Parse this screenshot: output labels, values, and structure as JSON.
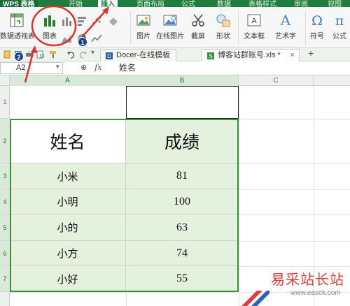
{
  "app": {
    "name": "WPS 表格"
  },
  "ribbon_tabs": [
    "开始",
    "插入",
    "页面布局",
    "公式",
    "数据",
    "表格样式",
    "审阅",
    "视图"
  ],
  "active_tab": "插入",
  "ribbon_buttons": {
    "pivot": "数据透视表",
    "chart": "图表",
    "picture": "图片",
    "online_picture": "在线图片",
    "screenshot": "截屏",
    "shapes": "形状",
    "textbox": "文本框",
    "wordart": "艺术字",
    "symbol": "符号",
    "formula": "公式"
  },
  "document_tabs": [
    "Docer-在线模板",
    "博客站群账号.xls *"
  ],
  "active_doc_tab": "博客站群账号.xls *",
  "name_box": "A2",
  "formula_bar": {
    "fx_label": "fx",
    "content": "姓名"
  },
  "columns": [
    "A",
    "B",
    "C"
  ],
  "rows": [
    "1",
    "2",
    "3",
    "4",
    "5",
    "6",
    "7"
  ],
  "table": {
    "headers": [
      "姓名",
      "成绩"
    ],
    "rows": [
      [
        "小米",
        "81"
      ],
      [
        "小明",
        "100"
      ],
      [
        "小的",
        "63"
      ],
      [
        "小方",
        "74"
      ],
      [
        "小好",
        "55"
      ]
    ]
  },
  "annotations": {
    "badge_1": "1",
    "badge_2": "2"
  },
  "watermark": {
    "title": "易采站长站",
    "url": "www.easck.com"
  },
  "colors": {
    "ribbon_green": "#1f7d3e",
    "data_fill": "#e4f1dd",
    "selection_border": "#3d8f3d",
    "annotation_red": "#d9342b",
    "badge_blue": "#1d3f8f"
  }
}
